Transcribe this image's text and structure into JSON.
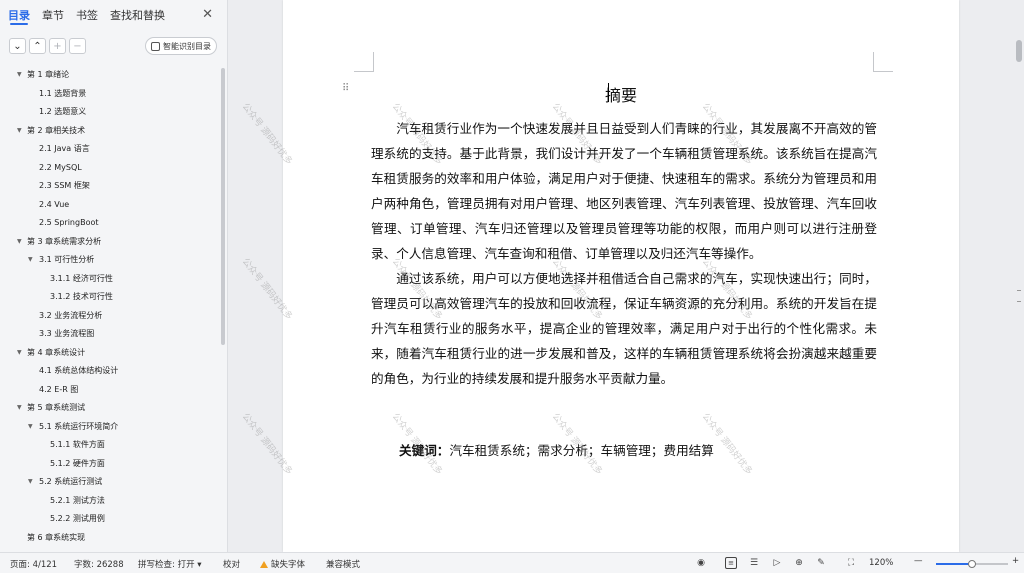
{
  "nav": {
    "tabs": [
      {
        "label": "目录",
        "active": true
      },
      {
        "label": "章节",
        "active": false
      },
      {
        "label": "书签",
        "active": false
      },
      {
        "label": "查找和替换",
        "active": false
      }
    ],
    "close_icon": "close-icon",
    "toolbar_icons": [
      "chevron-down-icon",
      "chevron-up-icon",
      "plus-icon",
      "minus-icon"
    ],
    "smart_button_label": "智能识别目录",
    "toc": [
      {
        "label": "第 1 章绪论",
        "level": 1,
        "arrow": true
      },
      {
        "label": "1.1 选题背景",
        "level": 2,
        "arrow": false
      },
      {
        "label": "1.2  选题意义",
        "level": 2,
        "arrow": false
      },
      {
        "label": "第 2 章相关技术",
        "level": 1,
        "arrow": true
      },
      {
        "label": "2.1 Java 语言",
        "level": 2,
        "arrow": false
      },
      {
        "label": "2.2 MySQL",
        "level": 2,
        "arrow": false
      },
      {
        "label": "2.3 SSM 框架",
        "level": 2,
        "arrow": false
      },
      {
        "label": "2.4 Vue",
        "level": 2,
        "arrow": false
      },
      {
        "label": "2.5 SpringBoot",
        "level": 2,
        "arrow": false
      },
      {
        "label": "第 3 章系统需求分析",
        "level": 1,
        "arrow": true
      },
      {
        "label": "3.1 可行性分析",
        "level": 2,
        "arrow": true
      },
      {
        "label": "3.1.1 经济可行性",
        "level": 3,
        "arrow": false
      },
      {
        "label": "3.1.2 技术可行性",
        "level": 3,
        "arrow": false
      },
      {
        "label": "3.2 业务流程分析",
        "level": 2,
        "arrow": false
      },
      {
        "label": "3.3 业务流程图",
        "level": 2,
        "arrow": false
      },
      {
        "label": "第 4 章系统设计",
        "level": 1,
        "arrow": true
      },
      {
        "label": "4.1  系统总体结构设计",
        "level": 2,
        "arrow": false
      },
      {
        "label": "4.2 E-R 图",
        "level": 2,
        "arrow": false
      },
      {
        "label": "第 5 章系统测试",
        "level": 1,
        "arrow": true
      },
      {
        "label": "5.1 系统运行环境简介",
        "level": 2,
        "arrow": true
      },
      {
        "label": "5.1.1 软件方面",
        "level": 3,
        "arrow": false
      },
      {
        "label": "5.1.2 硬件方面",
        "level": 3,
        "arrow": false
      },
      {
        "label": "5.2 系统运行测试",
        "level": 2,
        "arrow": true
      },
      {
        "label": "5.2.1 测试方法",
        "level": 3,
        "arrow": false
      },
      {
        "label": "5.2.2 测试用例",
        "level": 3,
        "arrow": false
      },
      {
        "label": "第 6 章系统实现",
        "level": 1,
        "arrow": false
      }
    ]
  },
  "document": {
    "title": "摘要",
    "paragraphs": [
      "汽车租赁行业作为一个快速发展并且日益受到人们青睐的行业，其发展离不开高效的管理系统的支持。基于此背景，我们设计并开发了一个车辆租赁管理系统。该系统旨在提高汽车租赁服务的效率和用户体验，满足用户对于便捷、快速租车的需求。系统分为管理员和用户两种角色，管理员拥有对用户管理、地区列表管理、汽车列表管理、投放管理、汽车回收管理、订单管理、汽车归还管理以及管理员管理等功能的权限，而用户则可以进行注册登录、个人信息管理、汽车查询和租借、订单管理以及归还汽车等操作。",
      "通过该系统，用户可以方便地选择并租借适合自己需求的汽车，实现快速出行；同时，管理员可以高效管理汽车的投放和回收流程，保证车辆资源的充分利用。系统的开发旨在提升汽车租赁行业的服务水平，提高企业的管理效率，满足用户对于出行的个性化需求。未来，随着汽车租赁行业的进一步发展和普及，这样的车辆租赁管理系统将会扮演越来越重要的角色，为行业的持续发展和提升服务水平贡献力量。"
    ],
    "keywords_label": "关键词：",
    "keywords_value": "汽车租赁系统；需求分析；车辆管理；费用结算",
    "watermark_text": "公众号 源码好优多"
  },
  "statusbar": {
    "page": "页面: 4/121",
    "word_count": "字数: 26288",
    "spell_check": "拼写检查: 打开",
    "spell_check_arrow": "▾",
    "proofread": "校对",
    "missing_fonts": "缺失字体",
    "compat_mode": "兼容模式",
    "zoom": "120%",
    "zoom_level_percent": 50,
    "zoom_minus": "—",
    "zoom_plus": "+",
    "icons": [
      "eye-icon",
      "page-view-icon",
      "outline-view-icon",
      "play-icon",
      "web-view-icon",
      "pen-icon",
      "fit-page-icon"
    ]
  },
  "colors": {
    "accent": "#2b6ce8",
    "warning": "#f0a020"
  }
}
